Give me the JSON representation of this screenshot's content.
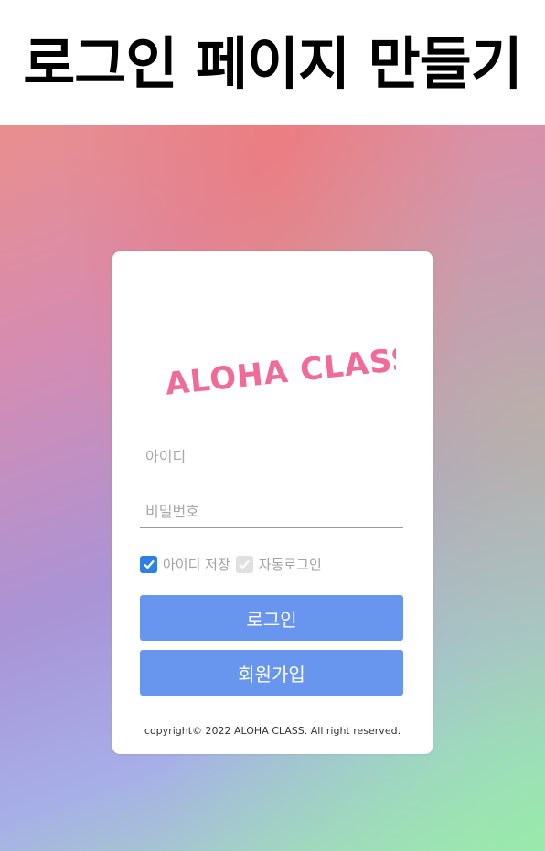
{
  "header": {
    "title": "로그인 페이지 만들기"
  },
  "logo": {
    "text": "ALOHA CLASS",
    "color": "#f06b98"
  },
  "form": {
    "id_placeholder": "아이디",
    "pw_placeholder": "비밀번호",
    "save_id_label": "아이디 저장",
    "save_id_checked": true,
    "auto_login_label": "자동로그인",
    "auto_login_checked": false
  },
  "buttons": {
    "login": "로그인",
    "signup": "회원가입"
  },
  "footer": {
    "copyright": "copyright© 2022 ALOHA CLASS. All right reserved."
  },
  "colors": {
    "accent": "#6896ee",
    "checkbox": "#2f7fe4"
  }
}
